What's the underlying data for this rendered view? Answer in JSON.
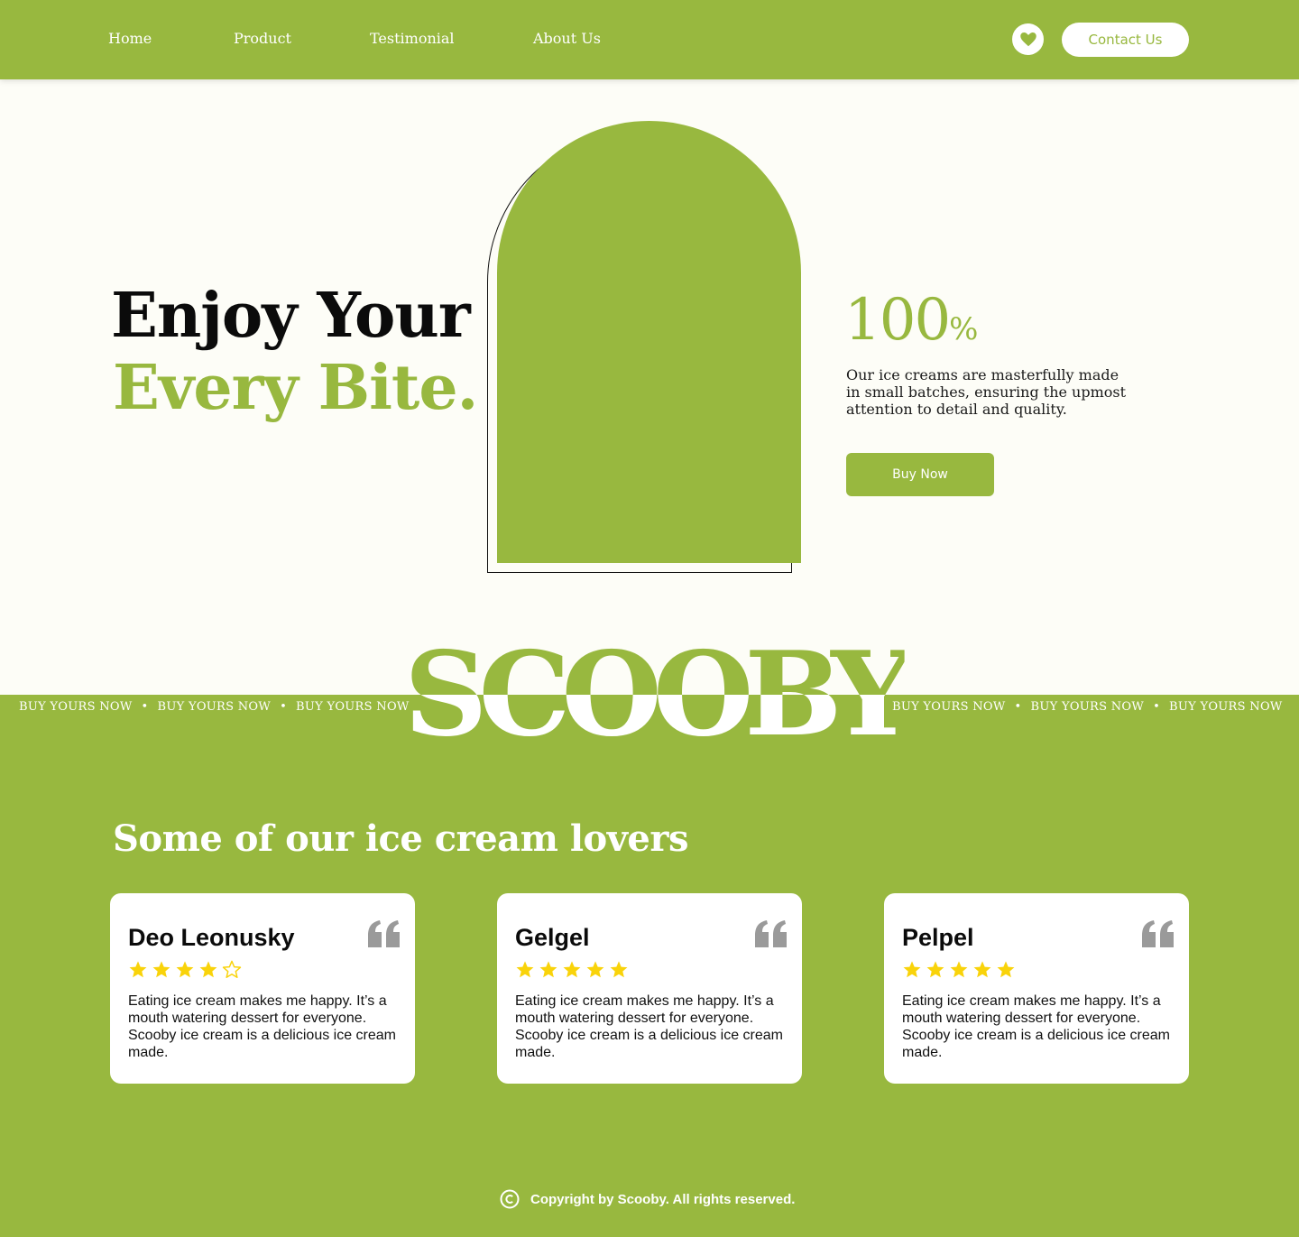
{
  "colors": {
    "accent": "#98b83f",
    "background": "#fdfdf7",
    "star": "#f9d30a",
    "quote": "#9a9a9a"
  },
  "nav": {
    "links": [
      "Home",
      "Product",
      "Testimonial",
      "About Us"
    ],
    "favorite_icon": "heart-icon",
    "contact_label": "Contact Us"
  },
  "hero": {
    "headline_line1": "Enjoy Your",
    "headline_line2": "Every Bite.",
    "stat_value": "100",
    "stat_unit": "%",
    "description": "Our ice creams are masterfully made in small batches, ensuring the upmost attention to detail and quality.",
    "buy_label": "Buy Now"
  },
  "brand": {
    "name": "SCOOBY",
    "marquee_text": "BUY YOURS NOW",
    "separator": "•"
  },
  "testimonials": {
    "title": "Some of our ice cream lovers",
    "quote_icon": "quote-icon",
    "items": [
      {
        "name": "Deo Leonusky",
        "rating": 4,
        "max_rating": 5,
        "text": "Eating ice cream makes me happy. It’s a mouth watering dessert for everyone. Scooby ice cream is a delicious ice cream made."
      },
      {
        "name": "Gelgel",
        "rating": 5,
        "max_rating": 5,
        "text": "Eating ice cream makes me happy. It’s a mouth watering dessert for everyone. Scooby ice cream is a delicious ice cream made."
      },
      {
        "name": "Pelpel",
        "rating": 5,
        "max_rating": 5,
        "text": "Eating ice cream makes me happy. It’s a mouth watering dessert for everyone. Scooby ice cream is a delicious ice cream made."
      }
    ]
  },
  "footer": {
    "copyright_icon": "copyright-icon",
    "text": "Copyright by Scooby. All rights reserved."
  }
}
